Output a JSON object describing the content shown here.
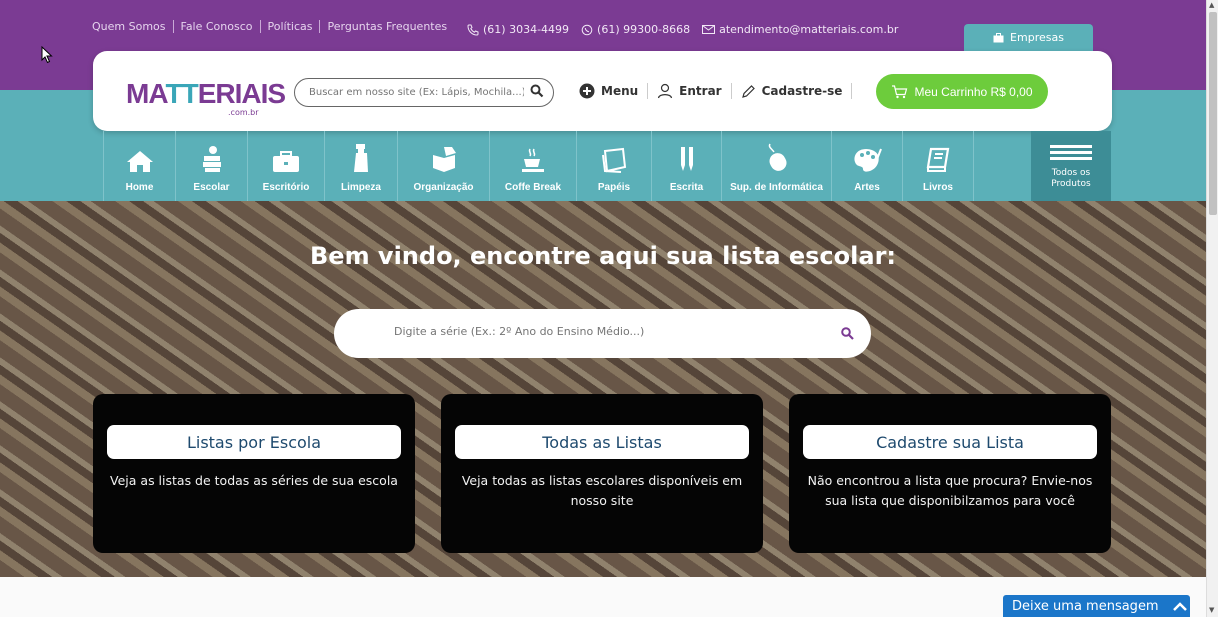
{
  "toplinks": [
    "Quem Somos",
    "Fale Conosco",
    "Políticas",
    "Perguntas Frequentes"
  ],
  "contacts": {
    "phone": "(61) 3034-4499",
    "whatsapp": "(61) 99300-8668",
    "email": "atendimento@matteriais.com.br"
  },
  "empresas_tab": "Empresas",
  "logo": {
    "part1": "MA",
    "part2": "TT",
    "part3": "ERIAIS",
    "sub": ".com.br"
  },
  "search": {
    "placeholder": "Buscar em nosso site (Ex: Lápis, Mochila...)"
  },
  "header_nav": {
    "menu": "Menu",
    "login": "Entrar",
    "register": "Cadastre-se"
  },
  "cart": {
    "label": "Meu Carrinho R$ 0,00"
  },
  "categories": [
    {
      "label": "Home",
      "icon": "home-icon"
    },
    {
      "label": "Escolar",
      "icon": "school-icon"
    },
    {
      "label": "Escritório",
      "icon": "briefcase-icon"
    },
    {
      "label": "Limpeza",
      "icon": "spray-bottle-icon"
    },
    {
      "label": "Organização",
      "icon": "box-icon"
    },
    {
      "label": "Coffe Break",
      "icon": "coffee-icon"
    },
    {
      "label": "Papéis",
      "icon": "paper-icon"
    },
    {
      "label": "Escrita",
      "icon": "pen-icon"
    },
    {
      "label": "Sup. de Informática",
      "icon": "mouse-icon"
    },
    {
      "label": "Artes",
      "icon": "palette-icon"
    },
    {
      "label": "Livros",
      "icon": "book-icon"
    }
  ],
  "todos": {
    "line1": "Todos os",
    "line2": "Produtos"
  },
  "hero": {
    "title": "Bem vindo, encontre aqui sua lista escolar:",
    "search_placeholder": "Digite a série (Ex.: 2º Ano do Ensino Médio...)"
  },
  "cards": [
    {
      "title": "Listas por Escola",
      "desc": "Veja as listas de todas as séries de sua escola"
    },
    {
      "title": "Todas as Listas",
      "desc": "Veja todas as listas escolares disponíveis em nosso site"
    },
    {
      "title": "Cadastre sua Lista",
      "desc": "Não encontrou a lista que procura? Envie-nos sua lista que disponibilzamos para você"
    }
  ],
  "chat": {
    "label": "Deixe uma mensagem"
  },
  "colors": {
    "purple": "#7b3b93",
    "teal": "#5bb0b8",
    "green": "#6dcc3c",
    "chat_blue": "#1b76c9"
  }
}
